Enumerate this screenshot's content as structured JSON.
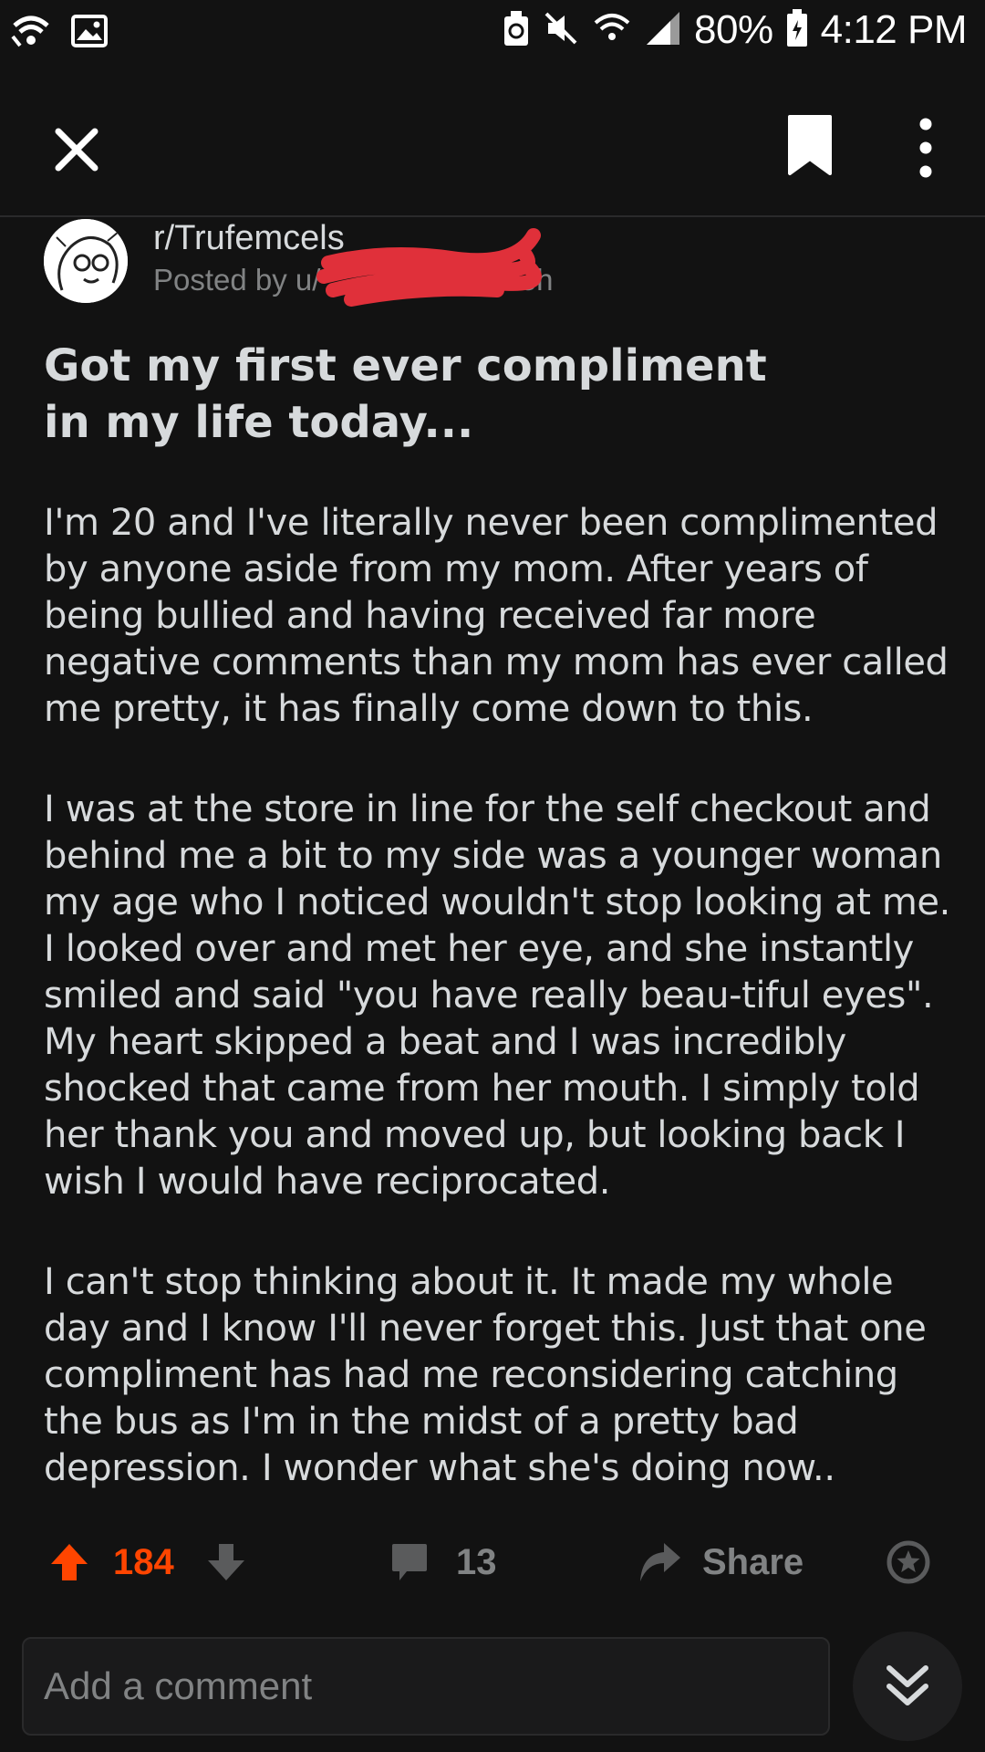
{
  "status_bar": {
    "battery": "80%",
    "time": "4:12 PM"
  },
  "post": {
    "subreddit": "r/Trufemcels",
    "posted_by_prefix": "Posted by u/",
    "age": "13h",
    "title": "Got my first ever compliment in my life today...",
    "paragraphs": [
      "I'm 20 and I've literally never been complimented by anyone aside from my mom. After years of being bullied and having received far more negative comments than my mom has ever called me pretty, it has finally come down to this.",
      "I was at the store in line for the self checkout and behind me a bit to my side was a younger woman my age who I noticed wouldn't stop looking at me. I looked over and met her eye, and she instantly smiled and said \"you have really beau-tiful eyes\". My heart skipped a beat and I was incredibly shocked that came from her mouth. I simply told her thank you and moved up, but looking back I wish I would have reciprocated.",
      "I can't stop thinking about it. It made my whole day and I know I'll never forget this. Just that one compliment has had me reconsidering catching the bus as I'm in the midst of a pretty bad depression. I wonder what she's doing now.."
    ]
  },
  "actions": {
    "votes": "184",
    "comments": "13",
    "share_label": "Share"
  },
  "comment_bar": {
    "placeholder": "Add a comment"
  },
  "colors": {
    "background": "#121212",
    "upvote": "#ff4500",
    "muted": "#818384",
    "text": "#d7dadc"
  }
}
